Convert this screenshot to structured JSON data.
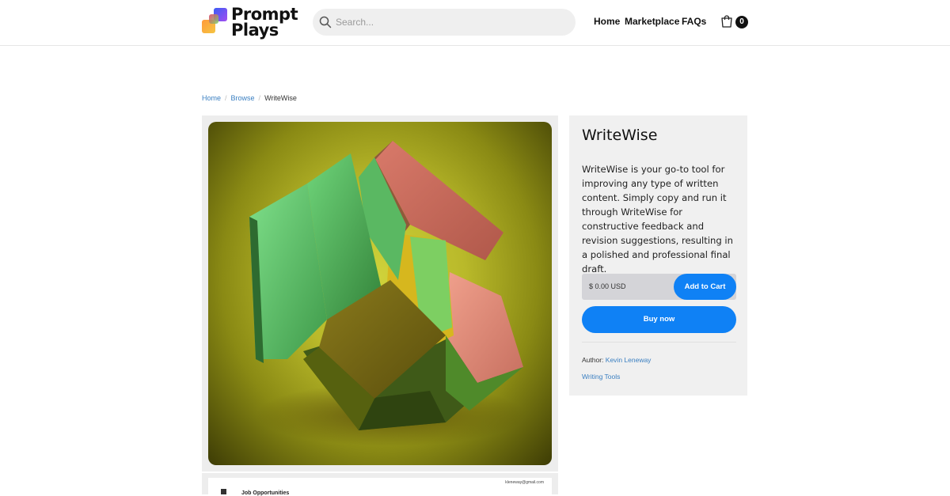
{
  "brand": {
    "line1": "Prompt",
    "line2": "Plays",
    "colors": [
      "#4a5cf0",
      "#d845c8",
      "#f5a623",
      "#33c28a"
    ]
  },
  "search": {
    "placeholder": "Search..."
  },
  "nav": {
    "home": "Home",
    "marketplace": "Marketplace",
    "faqs": "FAQs"
  },
  "cart": {
    "count": "0",
    "icon": "cart-icon"
  },
  "breadcrumb": {
    "home": "Home",
    "browse": "Browse",
    "current": "WriteWise"
  },
  "product": {
    "title": "WriteWise",
    "description": "WriteWise is your go-to tool for improving any type of written content. Simply copy and run it through WriteWise for constructive feedback and revision suggestions, resulting in a polished and professional final draft.",
    "price": "$ 0.00 USD",
    "add_to_cart": "Add to Cart",
    "buy_now": "Buy now",
    "author_label": "Author:",
    "author_name": "Kevin Leneway",
    "category": "Writing Tools"
  },
  "preview": {
    "email": "kleneway@gmail.com",
    "title": "Job Opportunities"
  },
  "colors": {
    "accent": "#0f81f5",
    "link": "#3a7fc1",
    "panel": "#f0f0f0"
  }
}
